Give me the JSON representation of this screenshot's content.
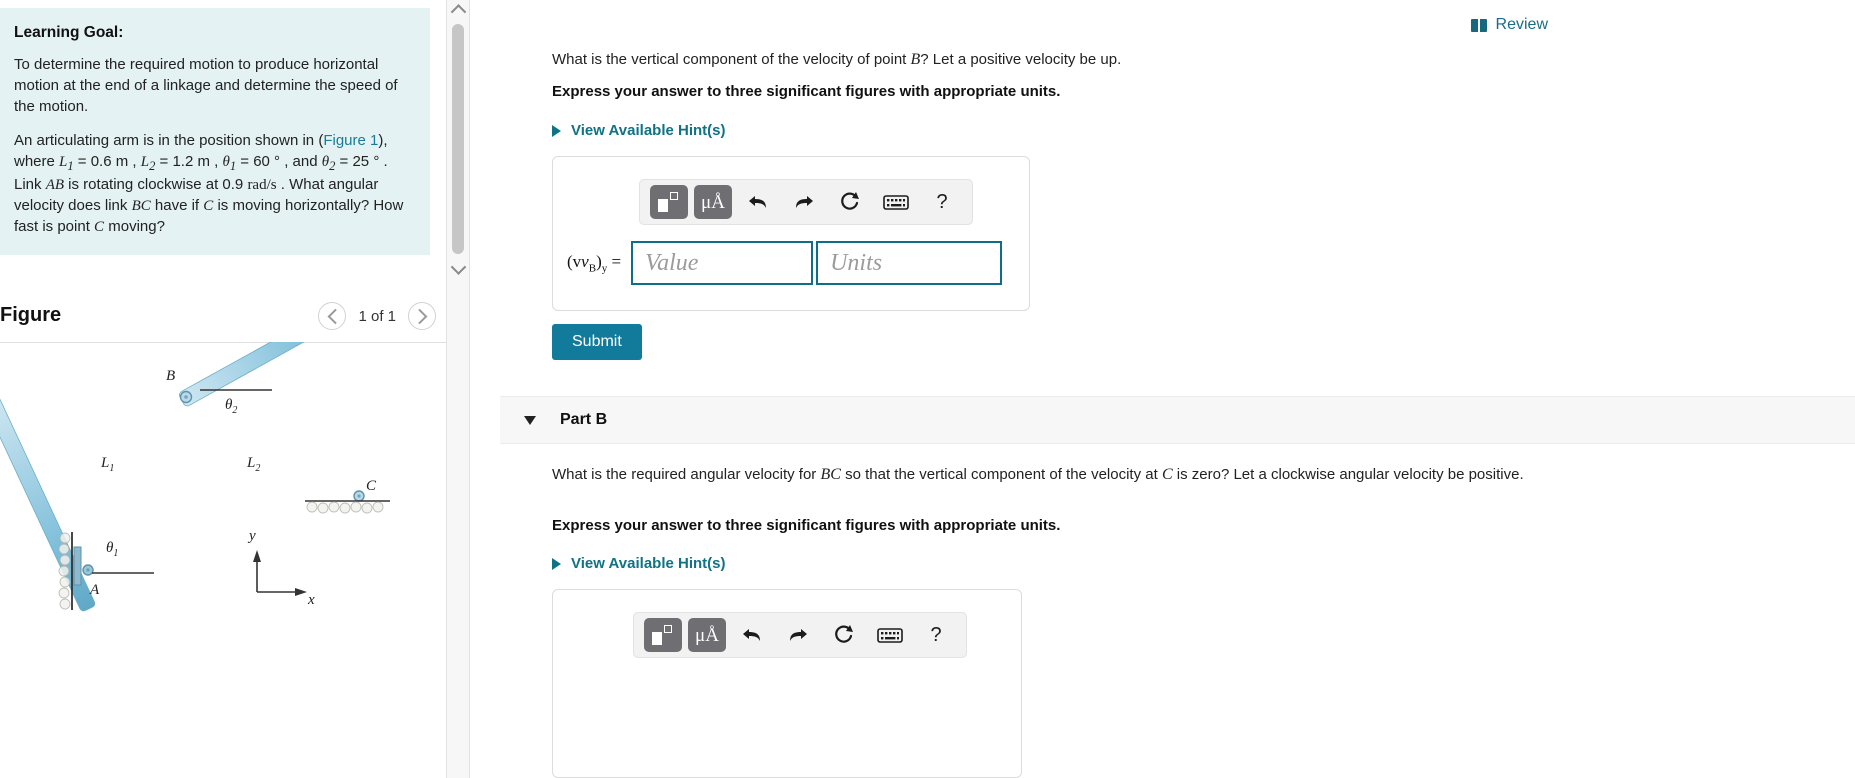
{
  "left": {
    "goal": {
      "title": "Learning Goal:",
      "body": "To determine the required motion to produce horizontal motion at the end of a linkage and determine the speed of the motion.",
      "problem_pre": "An articulating arm is in the position shown in (",
      "problem_link": "Figure 1",
      "problem_post": "), where ",
      "L1_sym": "L",
      "L1_sub": "1",
      "L1_val": " = 0.6 m , ",
      "L2_sym": "L",
      "L2_sub": "2",
      "L2_val": " = 1.2 m , ",
      "t1_sym": "θ",
      "t1_sub": "1",
      "t1_val": " = 60 ° , and ",
      "t2_sym": "θ",
      "t2_sub": "2",
      "t2_val": " = 25 ° . Link ",
      "AB": "AB",
      "mid": " is rotating clockwise at 0.9 ",
      "rate": "rad/s",
      "mid2": " . What angular velocity does link ",
      "BC": "BC",
      "mid3": " have if ",
      "C": "C",
      "tail": " is moving horizontally? How fast is point ",
      "C2": "C",
      "tail2": " moving?"
    },
    "figure": {
      "title": "Figure",
      "prev_icon": "chevron-left-icon",
      "next_icon": "chevron-right-icon",
      "count": "1 of 1",
      "labels": {
        "B": "B",
        "C": "C",
        "A": "A",
        "L1": "L",
        "L1sub": "1",
        "L2": "L",
        "L2sub": "2",
        "theta1": "θ",
        "theta1sub": "1",
        "theta2": "θ",
        "theta2sub": "2",
        "axis_y": "y",
        "axis_x": "x"
      }
    },
    "scrollbar": {
      "up_icon": "chevron-up-icon",
      "down_icon": "chevron-down-icon"
    }
  },
  "right": {
    "review": {
      "label": "Review",
      "icon": "book-icon"
    },
    "partA": {
      "question_pre": "What is the vertical component of the velocity of point ",
      "question_var": "B",
      "question_post": "? Let a positive velocity be up.",
      "instruction": "Express your answer to three significant figures with appropriate units.",
      "hint_label": "View Available Hint(s)",
      "hint_icon": "triangle-right-icon",
      "var_label_pre": "(v",
      "var_label_sub1": "B",
      "var_label_mid": ")",
      "var_label_sub2": "y",
      "var_label_eq": " =",
      "value_placeholder": "Value",
      "units_placeholder": "Units",
      "submit_label": "Submit",
      "toolbar": {
        "template_icon": "math-template-icon",
        "units_icon": "micro-angstrom-icon",
        "undo_icon": "undo-arrow-icon",
        "redo_icon": "redo-arrow-icon",
        "reset_icon": "reset-circular-arrow-icon",
        "keyboard_icon": "keyboard-icon",
        "help_icon": "question-mark-icon",
        "help_label": "?"
      }
    },
    "partB": {
      "header": "Part B",
      "collapse_icon": "triangle-down-icon",
      "question_pre": "What is the required angular velocity for ",
      "question_var": "BC",
      "question_mid": " so that the vertical component of the velocity at ",
      "question_var2": "C",
      "question_post": " is zero? Let a clockwise angular velocity be positive.",
      "instruction": "Express your answer to three significant figures with appropriate units.",
      "hint_label": "View Available Hint(s)",
      "hint_icon": "triangle-right-icon",
      "toolbar": {
        "template_icon": "math-template-icon",
        "units_icon": "micro-angstrom-icon",
        "undo_icon": "undo-arrow-icon",
        "redo_icon": "redo-arrow-icon",
        "reset_icon": "reset-circular-arrow-icon",
        "keyboard_icon": "keyboard-icon",
        "help_icon": "question-mark-icon",
        "help_label": "?"
      }
    }
  },
  "colors": {
    "accent": "#0f7285",
    "submit": "#127b9b",
    "goal_bg": "#e4f2f3",
    "link": "#1a7b96",
    "input_border": "#0d6f87",
    "link_blue": "#8fc6dd"
  }
}
